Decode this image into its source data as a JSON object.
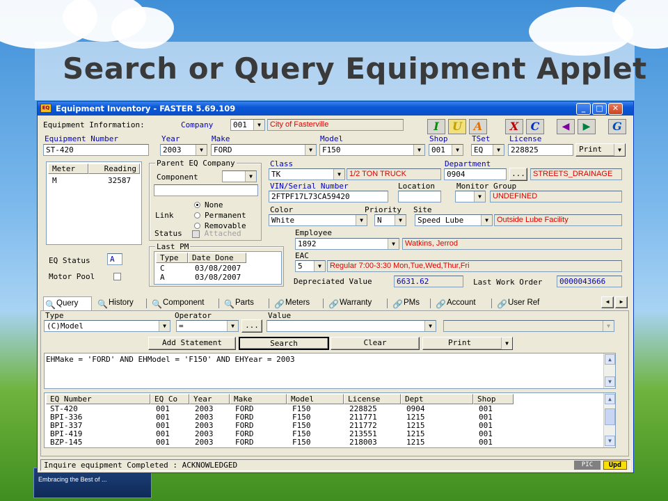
{
  "slide": {
    "title": "Search or Query Equipment Applet",
    "tagline": "Embracing the Best of ..."
  },
  "window": {
    "title": "Equipment Inventory - FASTER 5.69.109",
    "icon": "EQ"
  },
  "info": {
    "label": "Equipment Information:",
    "company_label": "Company",
    "company": "001",
    "company_name": "City of Fasterville"
  },
  "toolbar": [
    "I",
    "U",
    "A",
    "X",
    "C",
    "◀",
    "▶",
    "G"
  ],
  "fields": {
    "equipment_number": {
      "label": "Equipment Number",
      "value": "ST-420"
    },
    "year": {
      "label": "Year",
      "value": "2003"
    },
    "make": {
      "label": "Make",
      "value": "FORD"
    },
    "model": {
      "label": "Model",
      "value": "F150"
    },
    "shop": {
      "label": "Shop",
      "value": "001"
    },
    "tset": {
      "label": "TSet",
      "value": "EQ"
    },
    "license": {
      "label": "License",
      "value": "228825"
    },
    "print": "Print",
    "class": {
      "label": "Class",
      "value": "TK",
      "desc": "1/2 TON TRUCK"
    },
    "department": {
      "label": "Department",
      "value": "0904",
      "desc": "STREETS_DRAINAGE"
    },
    "vin": {
      "label": "VIN/Serial Number",
      "value": "2FTPF17L73CA59420"
    },
    "location": {
      "label": "Location",
      "value": ""
    },
    "monitor_group": {
      "label": "Monitor Group",
      "value": "",
      "desc": "UNDEFINED"
    },
    "color": {
      "label": "Color",
      "value": "White"
    },
    "priority": {
      "label": "Priority",
      "value": "N"
    },
    "site": {
      "label": "Site",
      "value": "Speed Lube",
      "desc": "Outside Lube Facility"
    },
    "employee": {
      "label": "Employee",
      "value": "1892",
      "desc": "Watkins, Jerrod"
    },
    "eac": {
      "label": "EAC",
      "value": "5",
      "desc": "Regular 7:00-3:30 Mon,Tue,Wed,Thur,Fri"
    },
    "depreciated": {
      "label": "Depreciated Value",
      "value": "6631.62"
    },
    "last_work_order": {
      "label": "Last Work Order",
      "value": "0000043666"
    },
    "eq_status": {
      "label": "EQ Status",
      "value": "A"
    },
    "motor_pool": {
      "label": "Motor Pool"
    }
  },
  "meters": {
    "headers": [
      "Meter",
      "Reading"
    ],
    "rows": [
      [
        "M",
        "32587"
      ]
    ]
  },
  "parent": {
    "title": "Parent EQ Company",
    "component_label": "Component",
    "link_label": "Link",
    "options": [
      "None",
      "Permanent",
      "Removable"
    ],
    "selected": "None",
    "status_label": "Status",
    "attached_label": "Attached"
  },
  "last_pm": {
    "title": "Last PM",
    "headers": [
      "Type",
      "Date Done"
    ],
    "rows": [
      [
        "C",
        "03/08/2007"
      ],
      [
        "A",
        "03/08/2007"
      ]
    ]
  },
  "tabs": [
    {
      "label": "Query",
      "icon": "🔍"
    },
    {
      "label": "History",
      "icon": "🔍"
    },
    {
      "label": "Component",
      "icon": "🔍"
    },
    {
      "label": "Parts",
      "icon": "🔍"
    },
    {
      "label": "Meters",
      "icon": "🔗"
    },
    {
      "label": "Warranty",
      "icon": "🔗"
    },
    {
      "label": "PMs",
      "icon": "🔗"
    },
    {
      "label": "Account",
      "icon": "🔗"
    },
    {
      "label": "User Ref",
      "icon": "🔗"
    }
  ],
  "query": {
    "type_label": "Type",
    "operator_label": "Operator",
    "value_label": "Value",
    "type": "(C)Model",
    "operator": "=",
    "value": "",
    "add_statement": "Add Statement",
    "search": "Search",
    "clear": "Clear",
    "print": "Print",
    "statement": "EHMake = 'FORD' AND   EHModel = 'F150' AND   EHYear = 2003"
  },
  "results": {
    "headers": [
      "EQ Number",
      "EQ Co",
      "Year",
      "Make",
      "Model",
      "License",
      "Dept",
      "Shop"
    ],
    "rows": [
      [
        "ST-420",
        "001",
        "2003",
        "FORD",
        "F150",
        "228825",
        "0904",
        "001"
      ],
      [
        "BPI-336",
        "001",
        "2003",
        "FORD",
        "F150",
        "211771",
        "1215",
        "001"
      ],
      [
        "BPI-337",
        "001",
        "2003",
        "FORD",
        "F150",
        "211772",
        "1215",
        "001"
      ],
      [
        "BPI-419",
        "001",
        "2003",
        "FORD",
        "F150",
        "213551",
        "1215",
        "001"
      ],
      [
        "BZP-145",
        "001",
        "2003",
        "FORD",
        "F150",
        "218003",
        "1215",
        "001"
      ]
    ]
  },
  "status": {
    "message": "Inquire equipment Completed : ACKNOWLEDGED",
    "pic": "PIC",
    "upd": "Upd"
  }
}
